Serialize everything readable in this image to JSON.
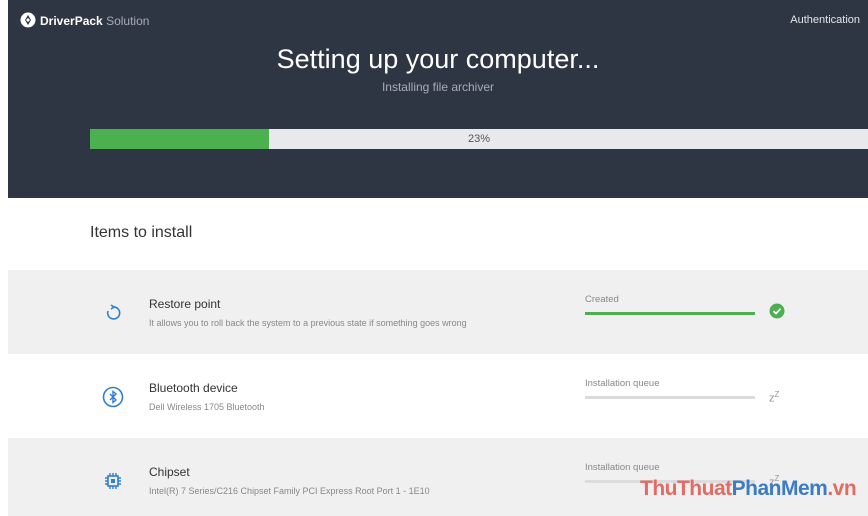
{
  "app": {
    "brand_bold": "DriverPack",
    "brand_light": "Solution",
    "auth_link": "Authentication"
  },
  "setup": {
    "title": "Setting up your computer...",
    "subtitle": "Installing file archiver",
    "progress_percent": 23,
    "progress_label": "23%"
  },
  "section": {
    "title": "Items to install"
  },
  "items": [
    {
      "icon": "restore-icon",
      "name": "Restore point",
      "desc": "It allows you to roll back the system to a previous state if something goes wrong",
      "status": "Created",
      "progress": 1.0,
      "state": "check-icon"
    },
    {
      "icon": "bluetooth-icon",
      "name": "Bluetooth device",
      "desc": "Dell Wireless 1705 Bluetooth",
      "status": "Installation queue",
      "progress": 0,
      "state": "sleep-icon"
    },
    {
      "icon": "chip-icon",
      "name": "Chipset",
      "desc": "Intel(R) 7 Series/C216 Chipset Family PCI Express Root Port 1 - 1E10",
      "status": "Installation queue",
      "progress": 0,
      "state": "sleep-icon"
    }
  ],
  "watermark": {
    "part1": "ThuThuat",
    "part2": "PhanMem",
    "part3": ".vn"
  },
  "colors": {
    "header_bg": "#2f3643",
    "accent_green": "#4caf50",
    "icon_blue": "#2f7fd1",
    "row_alt": "#f0f0f0"
  }
}
